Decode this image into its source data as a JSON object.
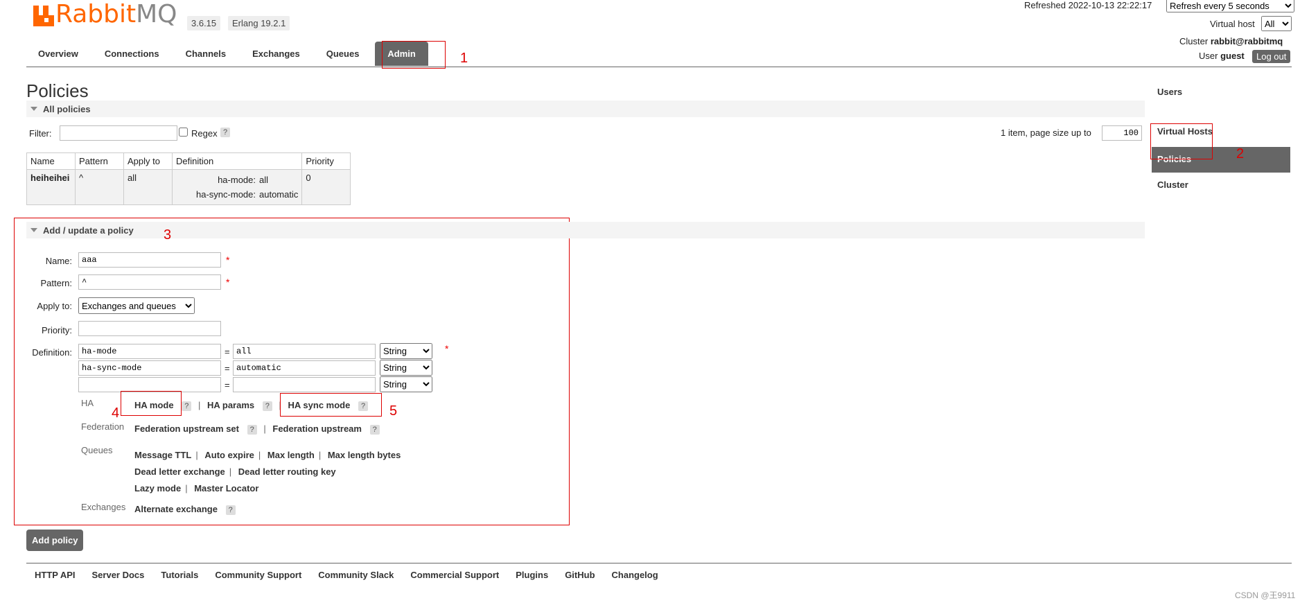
{
  "header": {
    "logo_text_left": "Rabbit",
    "logo_text_right": "MQ",
    "version": "3.6.15",
    "erlang": "Erlang 19.2.1",
    "refreshed": "Refreshed 2022-10-13 22:22:17",
    "refresh_select": "Refresh every 5 seconds",
    "vhost_label": "Virtual host",
    "vhost_value": "All",
    "cluster_label": "Cluster",
    "cluster_value": "rabbit@rabbitmq",
    "user_label": "User",
    "user_value": "guest",
    "logout": "Log out"
  },
  "tabs": [
    "Overview",
    "Connections",
    "Channels",
    "Exchanges",
    "Queues",
    "Admin"
  ],
  "side_nav": [
    "Users",
    "Virtual Hosts",
    "Policies",
    "Cluster"
  ],
  "page_title": "Policies",
  "all_policies": {
    "title": "All policies",
    "filter_label": "Filter:",
    "regex_label": "Regex",
    "help": "?",
    "pagination_text": "1 item, page size up to",
    "page_size": "100",
    "columns": [
      "Name",
      "Pattern",
      "Apply to",
      "Definition",
      "Priority"
    ],
    "row": {
      "name": "heiheihei",
      "pattern": "^",
      "apply_to": "all",
      "def1_key": "ha-mode:",
      "def1_val": "all",
      "def2_key": "ha-sync-mode:",
      "def2_val": "automatic",
      "priority": "0"
    }
  },
  "add_policy": {
    "title": "Add / update a policy",
    "name_label": "Name:",
    "name_value": "aaa",
    "pattern_label": "Pattern:",
    "pattern_value": "^",
    "apply_label": "Apply to:",
    "apply_value": "Exchanges and queues",
    "priority_label": "Priority:",
    "definition_label": "Definition:",
    "required": "*",
    "equals": "=",
    "defs": [
      {
        "key": "ha-mode",
        "value": "all",
        "type": "String"
      },
      {
        "key": "ha-sync-mode",
        "value": "automatic",
        "type": "String"
      },
      {
        "key": "",
        "value": "",
        "type": "String"
      }
    ],
    "cat_ha": "HA",
    "ha_mode": "HA mode",
    "ha_params": "HA params",
    "ha_sync_mode": "HA sync mode",
    "cat_federation": "Federation",
    "fed_upstream_set": "Federation upstream set",
    "fed_upstream": "Federation upstream",
    "cat_queues": "Queues",
    "q_message_ttl": "Message TTL",
    "q_auto_expire": "Auto expire",
    "q_max_length": "Max length",
    "q_max_length_bytes": "Max length bytes",
    "q_dlx": "Dead letter exchange",
    "q_dlrk": "Dead letter routing key",
    "q_lazy": "Lazy mode",
    "q_master_locator": "Master Locator",
    "cat_exchanges": "Exchanges",
    "ex_alternate": "Alternate exchange",
    "sep": "|",
    "button": "Add policy"
  },
  "annotations": [
    "1",
    "2",
    "3",
    "4",
    "5"
  ],
  "footer": [
    "HTTP API",
    "Server Docs",
    "Tutorials",
    "Community Support",
    "Community Slack",
    "Commercial Support",
    "Plugins",
    "GitHub",
    "Changelog"
  ],
  "watermark": "CSDN @王9911",
  "colors": {
    "brand": "#ff6600",
    "active": "#666666",
    "annotation": "#dd0000"
  }
}
